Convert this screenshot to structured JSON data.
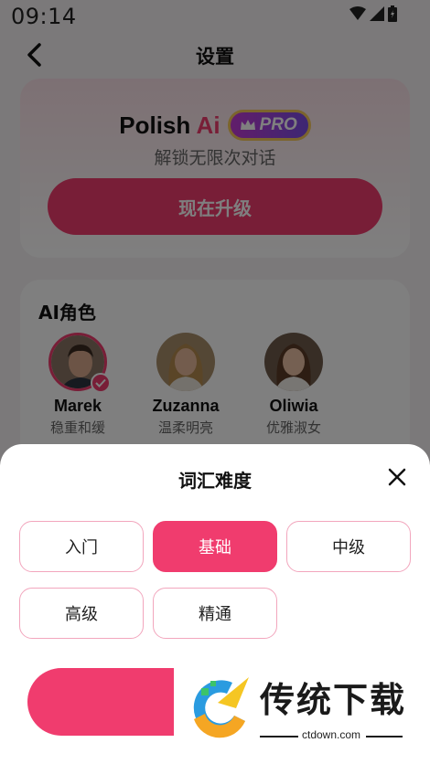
{
  "status_bar": {
    "time": "09:14",
    "icons": [
      "wifi-icon",
      "signal-icon",
      "battery-icon"
    ]
  },
  "header": {
    "title": "设置"
  },
  "pro_card": {
    "brand_name": "Polish",
    "brand_ai": "Ai",
    "badge": "PRO",
    "subtitle": "解锁无限次对话",
    "upgrade_label": "现在升级"
  },
  "ai_roles": {
    "title": "AI角色",
    "characters": [
      {
        "name": "Marek",
        "desc": "稳重和缓",
        "selected": true
      },
      {
        "name": "Zuzanna",
        "desc": "温柔明亮",
        "selected": false
      },
      {
        "name": "Oliwia",
        "desc": "优雅淑女",
        "selected": false
      }
    ]
  },
  "sheet": {
    "title": "词汇难度",
    "options": [
      {
        "label": "入门",
        "selected": false
      },
      {
        "label": "基础",
        "selected": true
      },
      {
        "label": "中级",
        "selected": false
      },
      {
        "label": "高级",
        "selected": false
      },
      {
        "label": "精通",
        "selected": false
      }
    ]
  },
  "watermark": {
    "text": "传统下载",
    "url": "ctdown.com"
  },
  "colors": {
    "accent": "#f03c6e",
    "option_border": "#f2a6bd"
  }
}
